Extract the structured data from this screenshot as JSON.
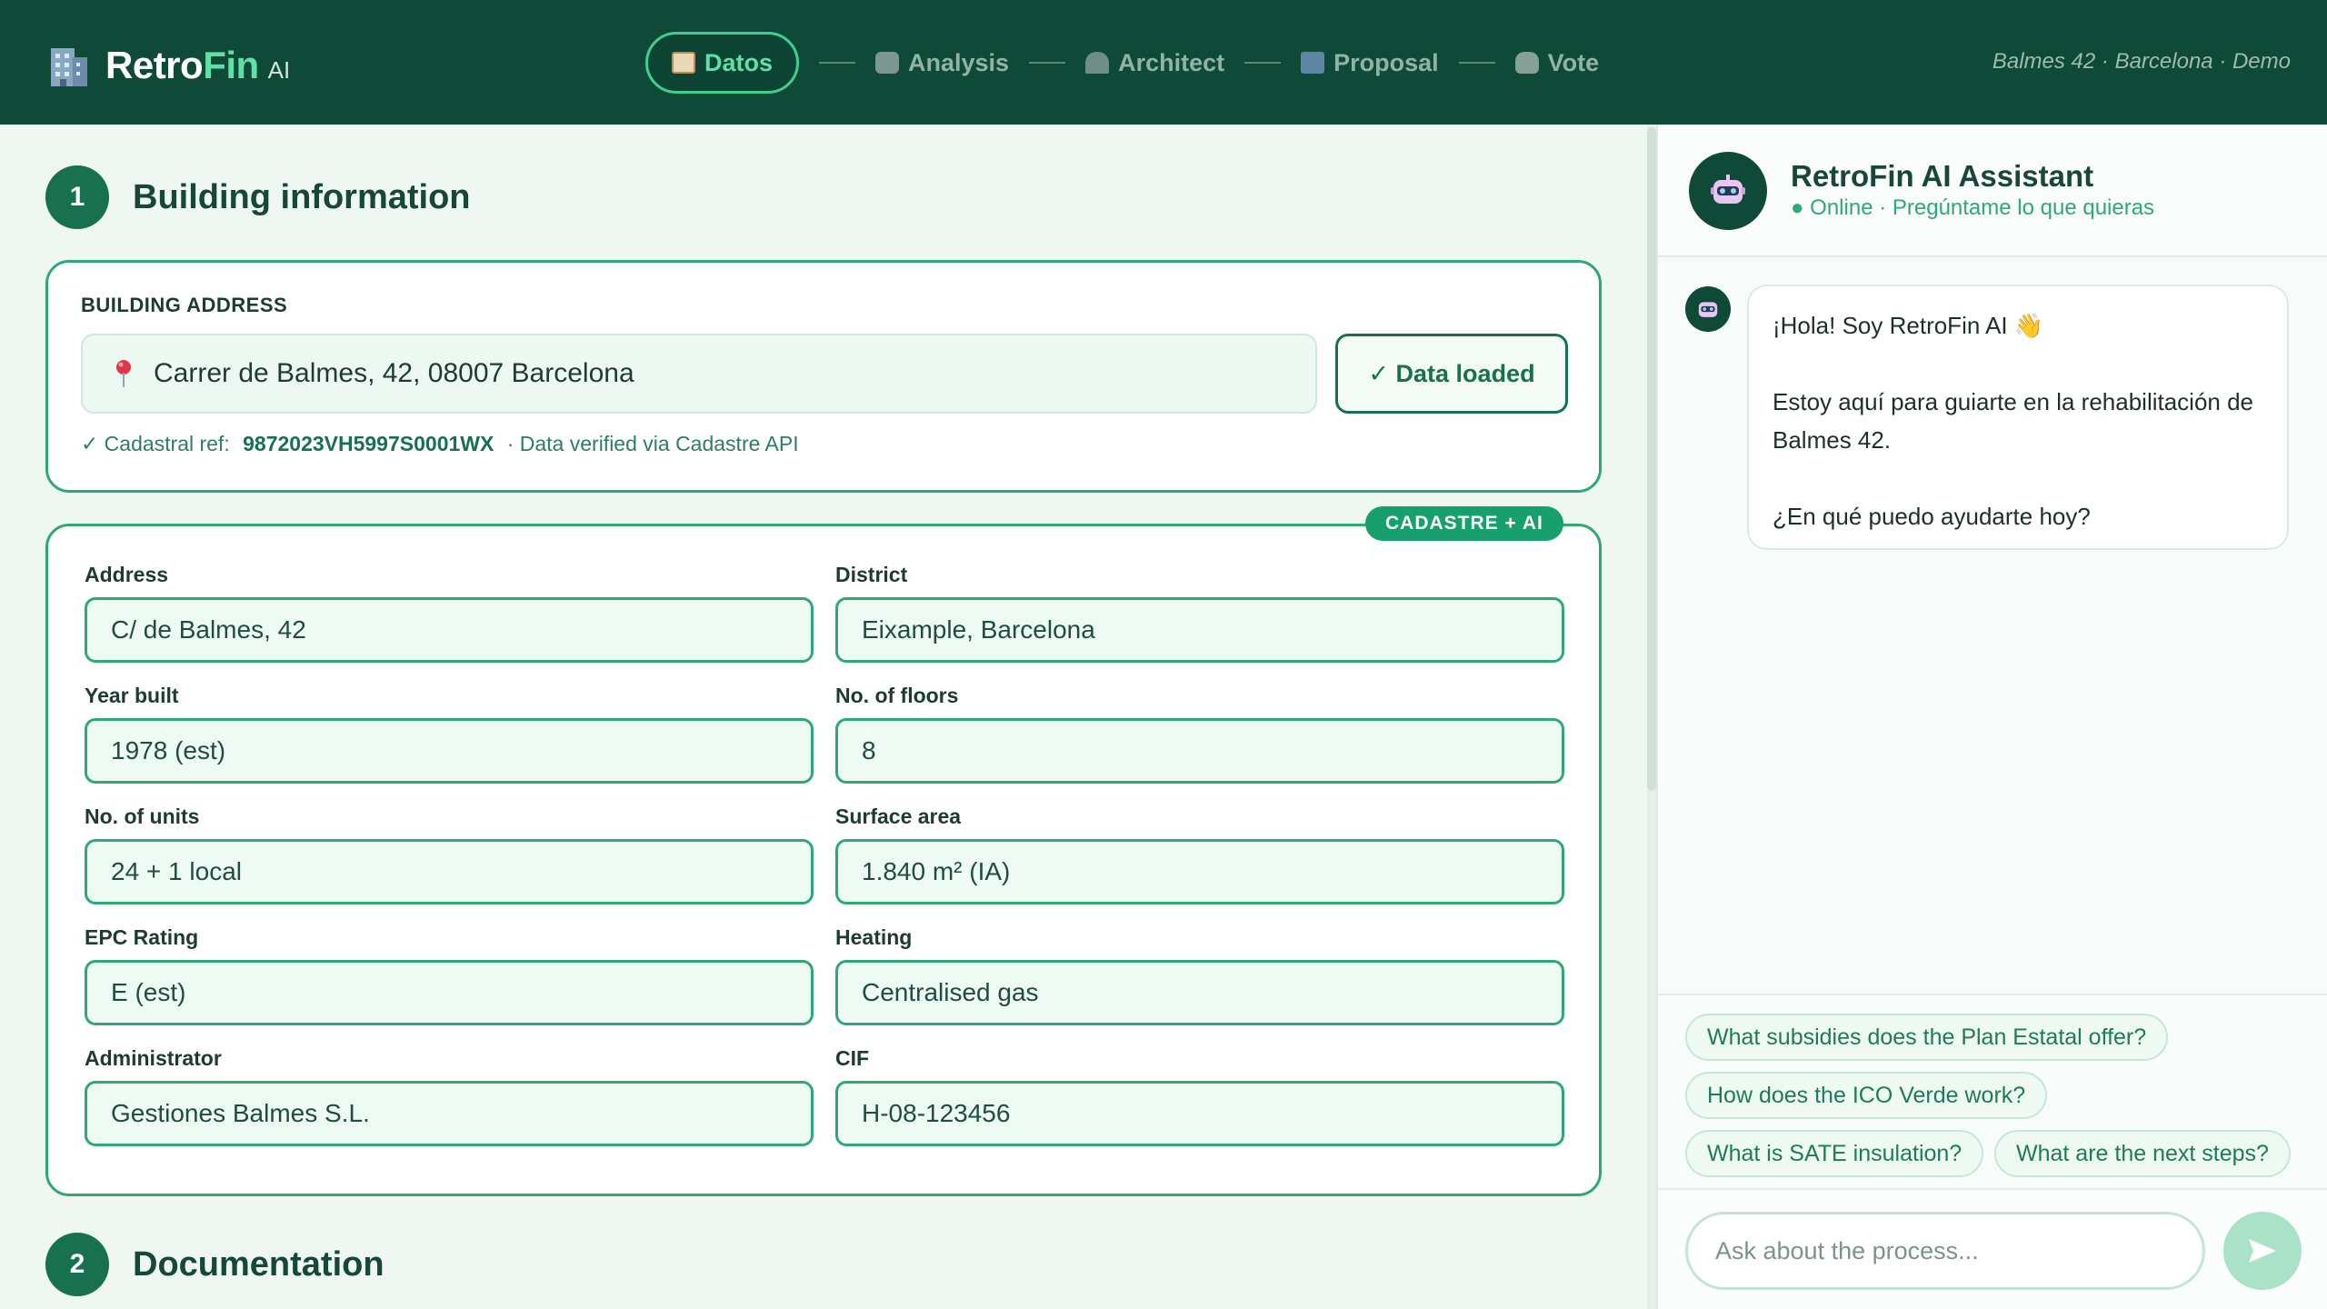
{
  "header": {
    "logo_retro": "Retro",
    "logo_fin": "Fin",
    "logo_ai": "AI",
    "steps": [
      {
        "label": "Datos",
        "icon": "clipboard-icon"
      },
      {
        "label": "Analysis",
        "icon": "robot-icon"
      },
      {
        "label": "Architect",
        "icon": "architect-icon"
      },
      {
        "label": "Proposal",
        "icon": "map-icon"
      },
      {
        "label": "Vote",
        "icon": "hand-icon"
      }
    ],
    "context": "Balmes 42 · Barcelona · Demo"
  },
  "section1": {
    "number": "1",
    "title": "Building information",
    "address_label": "BUILDING ADDRESS",
    "address_value": "Carrer de Balmes, 42, 08007 Barcelona",
    "loaded_button": "✓ Data loaded",
    "cadastral_prefix": "✓ Cadastral ref:",
    "cadastral_ref": "9872023VH5997S0001WX",
    "cadastral_suffix": "· Data verified via Cadastre API",
    "badge": "CADASTRE + AI",
    "fields": [
      {
        "label": "Address",
        "value": "C/ de Balmes, 42"
      },
      {
        "label": "District",
        "value": "Eixample, Barcelona"
      },
      {
        "label": "Year built",
        "value": "1978 (est)"
      },
      {
        "label": "No. of floors",
        "value": "8"
      },
      {
        "label": "No. of units",
        "value": "24 + 1 local"
      },
      {
        "label": "Surface area",
        "value": "1.840 m² (IA)"
      },
      {
        "label": "EPC Rating",
        "value": "E (est)"
      },
      {
        "label": "Heating",
        "value": "Centralised gas"
      },
      {
        "label": "Administrator",
        "value": "Gestiones Balmes S.L."
      },
      {
        "label": "CIF",
        "value": "H-08-123456"
      }
    ]
  },
  "section2": {
    "number": "2",
    "title": "Documentation"
  },
  "chat": {
    "title": "RetroFin AI Assistant",
    "status": "● Online · Pregúntame lo que quieras",
    "message_lines": [
      "¡Hola! Soy RetroFin AI 👋",
      "Estoy aquí para guiarte en la rehabilitación de Balmes 42.",
      "¿En qué puedo ayudarte hoy?"
    ],
    "suggestions": [
      "What subsidies does the Plan Estatal offer?",
      "How does the ICO Verde work?",
      "What is SATE insulation?",
      "What are the next steps?"
    ],
    "input_placeholder": "Ask about the process..."
  },
  "colors": {
    "header_bg": "#0f4a38",
    "accent": "#2ea876",
    "accent_light": "#5fe0a6",
    "badge": "#17a06e"
  }
}
